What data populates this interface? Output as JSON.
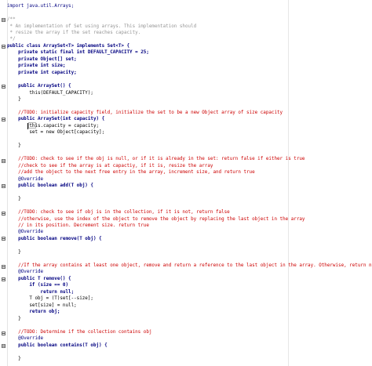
{
  "editor": {
    "lines": [
      "import java.util.Arrays;",
      "",
      "/**",
      " * An implementation of Set using arrays. This implementation should",
      " * resize the array if the set reaches capacity.",
      " */",
      "public class ArraySet<T> implements Set<T> {",
      "    private static final int DEFAULT_CAPACITY = 25;",
      "    private Object[] set;",
      "    private int size;",
      "    private int capacity;",
      "",
      "    public ArraySet() {",
      "        this(DEFAULT_CAPACITY);",
      "    }",
      "",
      "    //TODO: initialize capacity field, initialize the set to be a new Object array of size capacity",
      "    public ArraySet(int capacity) {",
      "        this.capacity = capacity;",
      "        set = new Object[capacity];",
      "",
      "    }",
      "",
      "    //TODO: check to see if the obj is null, or if it is already in the set: return false if either is true",
      "    //check to see if the array is at capactiy, if it is, resize the array",
      "    //add the object to the next free entry in the array, increment size, and return true",
      "    @Override",
      "    public boolean add(T obj) {",
      "",
      "    }",
      "",
      "    //TODO: check to see if obj is in the collection, if it is not, return false",
      "    //otherwise, use the index of the object to remove the object by replacing the last object in the array",
      "    // in its position. Decrement size. return true",
      "    @Override",
      "    public boolean remove(T obj) {",
      "",
      "    }",
      "",
      "    //If the array contains at least one object, remove and return a reference to the last object in the array. Otherwise, return null.",
      "    @Override",
      "    public T remove() {",
      "        if (size == 0)",
      "            return null;",
      "        T obj = (T)set[--size];",
      "        set[size] = null;",
      "        return obj;",
      "    }",
      "",
      "    //TODO: Determine if the collection contains obj",
      "    @Override",
      "    public boolean contains(T obj) {",
      "",
      "    }"
    ]
  }
}
